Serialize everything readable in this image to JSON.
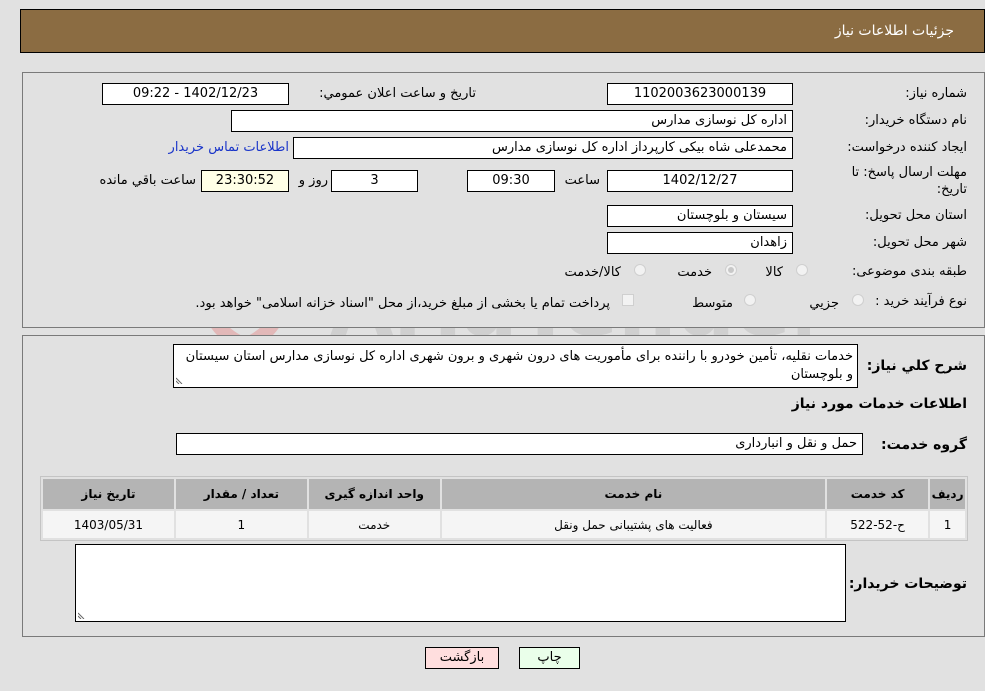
{
  "header": {
    "title": "جزئیات اطلاعات نیاز"
  },
  "form": {
    "need_number": {
      "label": "شماره نیاز:",
      "value": "1102003623000139"
    },
    "announce_datetime": {
      "label": "تاریخ و ساعت اعلان عمومي:",
      "value": "1402/12/23 - 09:22"
    },
    "buyer_org": {
      "label": "نام دستگاه خریدار:",
      "value": "اداره کل نوسازی مدارس"
    },
    "requester": {
      "label": "ایجاد کننده درخواست:",
      "value": "محمدعلی شاه بیکی کارپرداز اداره کل نوسازی مدارس",
      "contact_link": "اطلاعات تماس خریدار"
    },
    "deadline": {
      "label": "مهلت ارسال پاسخ: تا تاریخ:",
      "date": "1402/12/27",
      "time_label": "ساعت",
      "time": "09:30",
      "days": "3",
      "days_label": "روز و",
      "remaining": "23:30:52",
      "remaining_label": "ساعت باقي مانده"
    },
    "province": {
      "label": "استان محل تحویل:",
      "value": "سیستان و بلوچستان"
    },
    "city": {
      "label": "شهر محل تحویل:",
      "value": "زاهدان"
    },
    "category": {
      "label": "طبقه بندی موضوعی:",
      "options": [
        "کالا",
        "خدمت",
        "کالا/خدمت"
      ],
      "selected": "خدمت"
    },
    "purchase_type": {
      "label": "نوع فرآیند خرید :",
      "options": [
        "جزيي",
        "متوسط"
      ],
      "note": "پرداخت تمام یا بخشی از مبلغ خرید،از محل \"اسناد خزانه اسلامی\" خواهد بود."
    }
  },
  "description": {
    "label": "شرح کلي نیاز:",
    "value": "خدمات نقلیه، تأمین خودرو با راننده برای مأموریت های درون شهری و برون شهری اداره کل نوسازی مدارس استان سیستان و بلوچستان"
  },
  "services": {
    "section_title": "اطلاعات خدمات مورد نیاز",
    "group_label": "گروه خدمت:",
    "group_value": "حمل و نقل و انبارداری",
    "columns": [
      "ردیف",
      "کد خدمت",
      "نام خدمت",
      "واحد اندازه گیری",
      "تعداد / مقدار",
      "تاریخ نیاز"
    ],
    "rows": [
      [
        "1",
        "ح-52-522",
        "فعالیت های پشتیبانی حمل ونقل",
        "خدمت",
        "1",
        "1403/05/31"
      ]
    ]
  },
  "buyer_notes": {
    "label": "توضیحات خریدار:",
    "value": ""
  },
  "buttons": {
    "print": "چاپ",
    "back": "بازگشت"
  },
  "watermark": {
    "text": "AriaTender.neT"
  },
  "colors": {
    "header_bg": "#8b6c42",
    "link": "#1a35c9",
    "print_bg": "#eaffea",
    "back_bg": "#ffdede",
    "remaining_bg": "#ffffe6"
  }
}
